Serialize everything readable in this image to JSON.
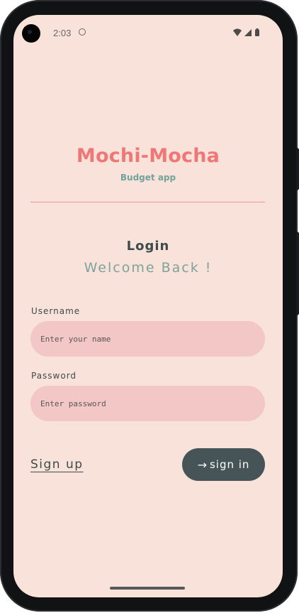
{
  "status_bar": {
    "time": "2:03",
    "icons": [
      "wifi-icon",
      "cell-signal-icon",
      "battery-icon"
    ]
  },
  "app": {
    "name": "Mochi-Mocha",
    "subtitle": "Budget app"
  },
  "login": {
    "title": "Login",
    "welcome": "Welcome Back !"
  },
  "form": {
    "username": {
      "label": "Username",
      "value": "",
      "placeholder": "Enter your name"
    },
    "password": {
      "label": "Password",
      "value": "",
      "placeholder": "Enter password"
    }
  },
  "actions": {
    "signup_label": "Sign up",
    "signin_arrow": "→",
    "signin_label": "sign in"
  },
  "colors": {
    "background": "#f8e2d9",
    "brand": "#ee7877",
    "accent": "#72a29a",
    "field": "#f2c7c6",
    "button": "#465457"
  }
}
